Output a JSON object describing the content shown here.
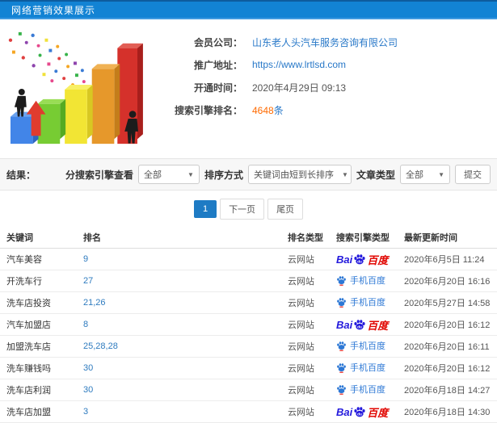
{
  "header": {
    "title": "网络营销效果展示"
  },
  "info": {
    "member_label": "会员公司：",
    "member_value": "山东老人头汽车服务咨询有限公司",
    "promo_label": "推广地址：",
    "promo_value": "https://www.lrtlsd.com",
    "open_label": "开通时间：",
    "open_value": "2020年4月29日 09:13",
    "rank_label": "搜索引擎排名：",
    "rank_count": "4648",
    "rank_unit": "条"
  },
  "filters": {
    "result_label": "结果：",
    "engine_filter_label": "分搜索引擎查看",
    "engine_filter_value": "全部",
    "sort_label": "排序方式",
    "sort_value": "关键词由短到长排序",
    "article_label": "文章类型",
    "article_value": "全部",
    "submit_label": "提交"
  },
  "pagination": {
    "current": "1",
    "next": "下一页",
    "last": "尾页"
  },
  "table": {
    "headers": [
      "关键词",
      "排名",
      "排名类型",
      "搜索引擎类型",
      "最新更新时间"
    ],
    "logo": {
      "bai": "Bai",
      "baidu": "百度",
      "mobile": "手机百度"
    },
    "rows": [
      {
        "keyword": "汽车美容",
        "rank": "9",
        "rank_type": "云网站",
        "engine": "百度",
        "updated": "2020年6月5日 11:24"
      },
      {
        "keyword": "开洗车行",
        "rank": "27",
        "rank_type": "云网站",
        "engine": "手机百度",
        "updated": "2020年6月20日 16:16"
      },
      {
        "keyword": "洗车店投资",
        "rank": "21,26",
        "rank_type": "云网站",
        "engine": "手机百度",
        "updated": "2020年5月27日 14:58"
      },
      {
        "keyword": "汽车加盟店",
        "rank": "8",
        "rank_type": "云网站",
        "engine": "百度",
        "updated": "2020年6月20日 16:12"
      },
      {
        "keyword": "加盟洗车店",
        "rank": "25,28,28",
        "rank_type": "云网站",
        "engine": "手机百度",
        "updated": "2020年6月20日 16:11"
      },
      {
        "keyword": "洗车赚钱吗",
        "rank": "30",
        "rank_type": "云网站",
        "engine": "手机百度",
        "updated": "2020年6月20日 16:12"
      },
      {
        "keyword": "洗车店利润",
        "rank": "30",
        "rank_type": "云网站",
        "engine": "手机百度",
        "updated": "2020年6月18日 14:27"
      },
      {
        "keyword": "洗车店加盟",
        "rank": "3",
        "rank_type": "云网站",
        "engine": "百度",
        "updated": "2020年6月18日 14:30"
      }
    ]
  }
}
